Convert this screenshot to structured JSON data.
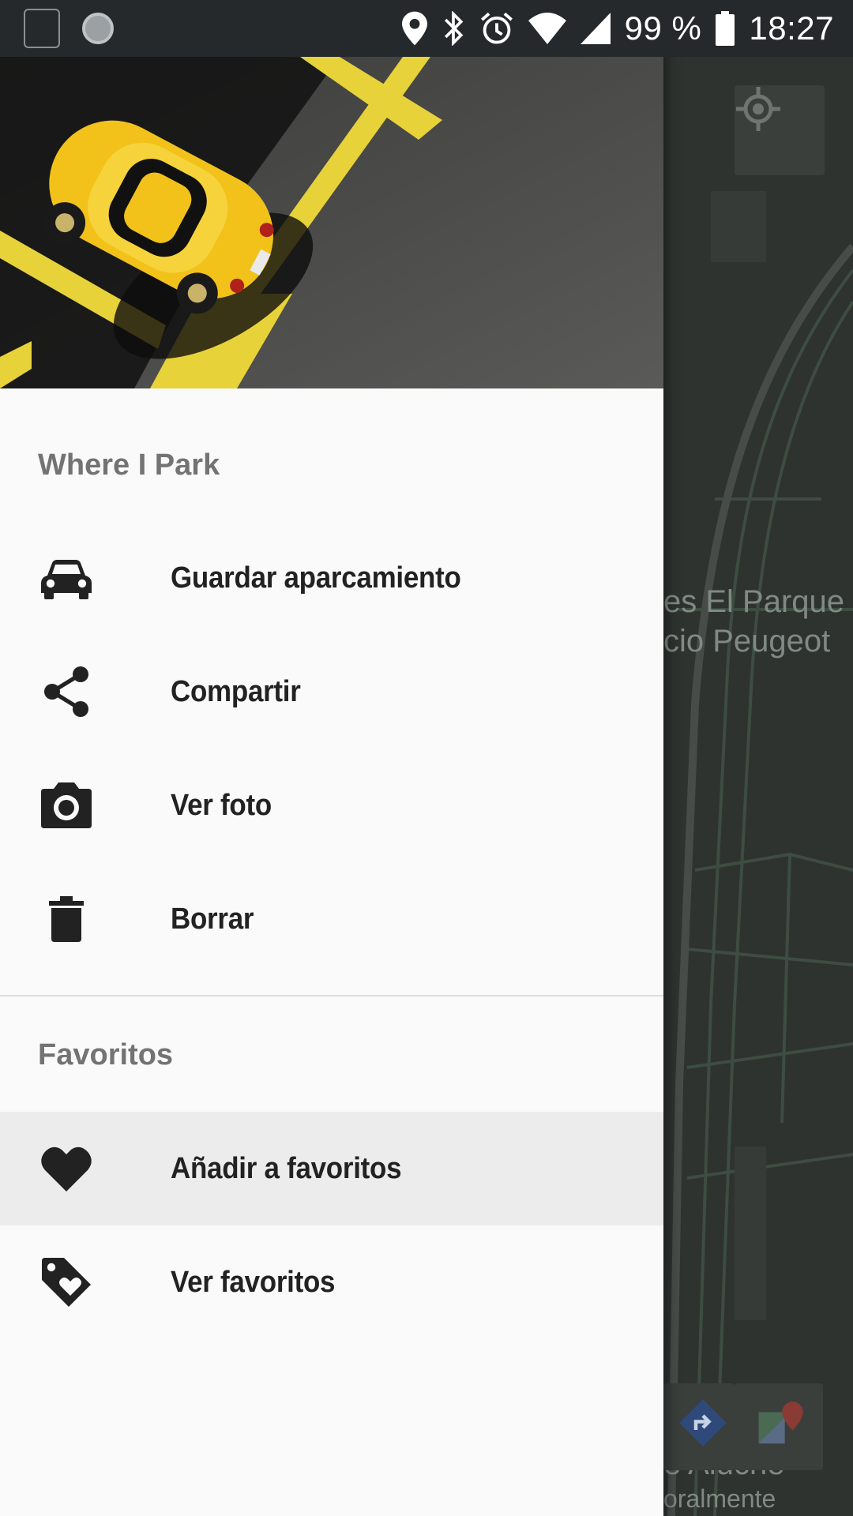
{
  "status_bar": {
    "battery": "99 %",
    "time": "18:27",
    "icons": [
      "notification-square-icon",
      "loading-icon",
      "location-icon",
      "bluetooth-icon",
      "alarm-icon",
      "wifi-icon",
      "signal-icon",
      "battery-icon"
    ]
  },
  "drawer": {
    "app_title": "Where I Park",
    "header_image": "yellow-car-parking-photo",
    "menu": [
      {
        "label": "Guardar aparcamiento",
        "icon": "car-icon"
      },
      {
        "label": "Compartir",
        "icon": "share-icon"
      },
      {
        "label": "Ver foto",
        "icon": "camera-icon"
      },
      {
        "label": "Borrar",
        "icon": "trash-icon"
      }
    ],
    "favorites_title": "Favoritos",
    "favorites": [
      {
        "label": "Añadir a favoritos",
        "icon": "heart-icon",
        "selected": true
      },
      {
        "label": "Ver favoritos",
        "icon": "tag-heart-icon",
        "selected": false
      }
    ]
  },
  "map": {
    "labels": [
      "es El Parque",
      "cio Peugeot",
      "e Aluche",
      "oralmente"
    ],
    "buttons": [
      "my-location-icon",
      "directions-icon",
      "google-maps-icon"
    ]
  },
  "colors": {
    "drawer_bg": "#fafafa",
    "selected_bg": "#ececec",
    "status_bar": "#26292b",
    "map_bg": "#2e3330",
    "section_title": "#737373",
    "item_text": "#222222",
    "car_yellow": "#f2c21b"
  }
}
